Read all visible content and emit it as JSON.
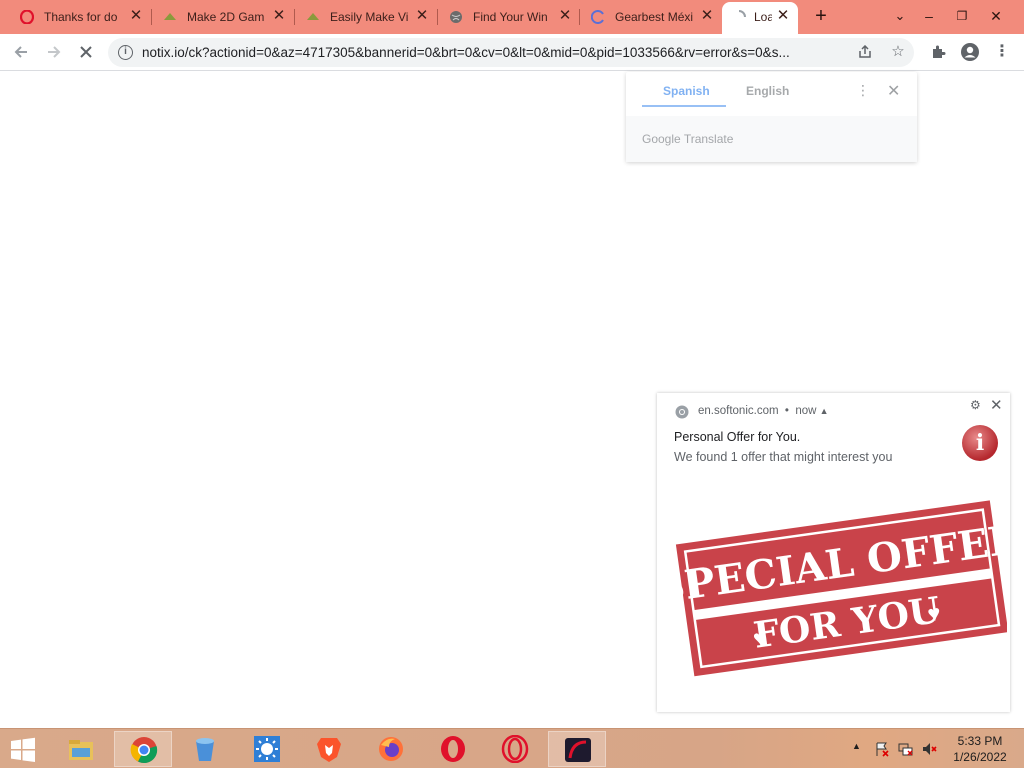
{
  "tabs": [
    {
      "label": "Thanks for do",
      "icon": "opera-icon"
    },
    {
      "label": "Make 2D Gam",
      "icon": "game-icon"
    },
    {
      "label": "Easily Make Vi",
      "icon": "game-icon"
    },
    {
      "label": "Find Your Win",
      "icon": "globe-icon"
    },
    {
      "label": "Gearbest Méxi",
      "icon": "loading-icon"
    },
    {
      "label": "Loa",
      "icon": "loading-icon",
      "active": true
    }
  ],
  "window_controls": {
    "minimize": "–",
    "maximize": "❐",
    "close": "✕"
  },
  "address_bar": {
    "url": "notix.io/ck?actionid=0&az=4717305&bannerid=0&brt=0&cv=0&lt=0&mid=0&pid=1033566&rv=error&s=0&s..."
  },
  "translate_popup": {
    "source_language": "Spanish",
    "target_language": "English",
    "footer": "Google Translate"
  },
  "notification": {
    "site": "en.softonic.com",
    "time": "now",
    "title": "Personal Offer for You.",
    "message": "We found 1 offer that might interest you",
    "image_text_line1": "SPECIAL OFFER",
    "image_text_line2": "FOR YOU",
    "accent": "#c9434a"
  },
  "taskbar": {
    "apps": [
      "file-explorer-icon",
      "chrome-icon",
      "recycle-bin-icon",
      "brightness-icon",
      "brave-icon",
      "firefox-icon",
      "opera-icon",
      "opera-gx-icon",
      "app-icon"
    ]
  },
  "clock": {
    "time": "5:33 PM",
    "date": "1/26/2022"
  }
}
